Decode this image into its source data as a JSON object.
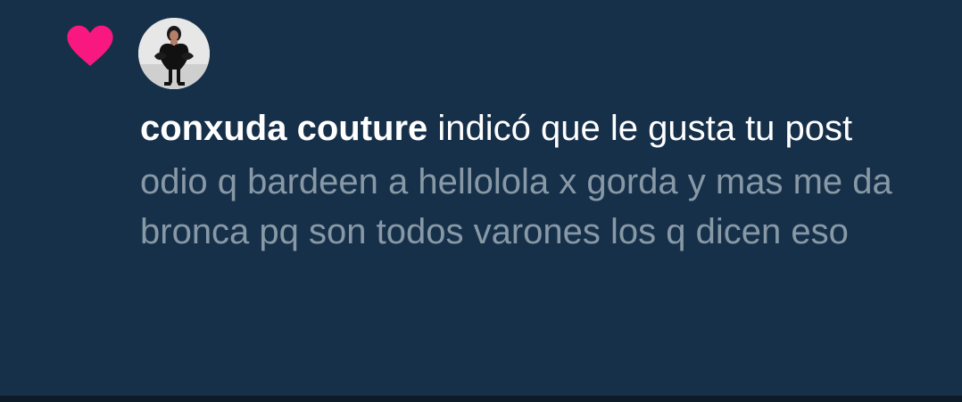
{
  "notification": {
    "type_icon": "heart-icon",
    "avatar_icon": "avatar",
    "user_name": "conxuda couture",
    "action_text": " indicó que le gusta tu post",
    "post_preview": "odio q bardeen a hellolola x gorda y mas me da bronca pq son todos varones los q dicen eso"
  },
  "colors": {
    "background": "#17304a",
    "heart": "#f91880",
    "primary_text": "#ffffff",
    "secondary_text": "#8899a6"
  }
}
